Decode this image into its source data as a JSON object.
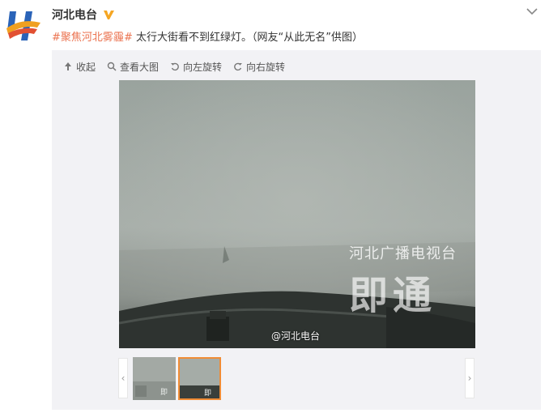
{
  "post": {
    "username": "河北电台",
    "verified_icon": "verified-v-icon",
    "text": {
      "tag1_open": "#",
      "tag1_part1": "聚焦河北",
      "tag1_part2": "雾霾",
      "tag1_close": "#",
      "body": " 太行大街看不到红绿灯。（网友“从此无名”供图）"
    }
  },
  "toolbar": {
    "collapse": "收起",
    "view_large": "查看大图",
    "rotate_left": "向左旋转",
    "rotate_right": "向右旋转"
  },
  "photo": {
    "watermark_credit": "@河北电台",
    "logo_line1": "河北广播电视台",
    "logo_line2": "即通"
  },
  "thumbnails": {
    "count": 2,
    "selected_index": 1
  },
  "colors": {
    "accent_tag": "#eb7350",
    "accent_blue": "#3b7bc1",
    "selected_border": "#f08c35",
    "verified": "#f5a623"
  }
}
